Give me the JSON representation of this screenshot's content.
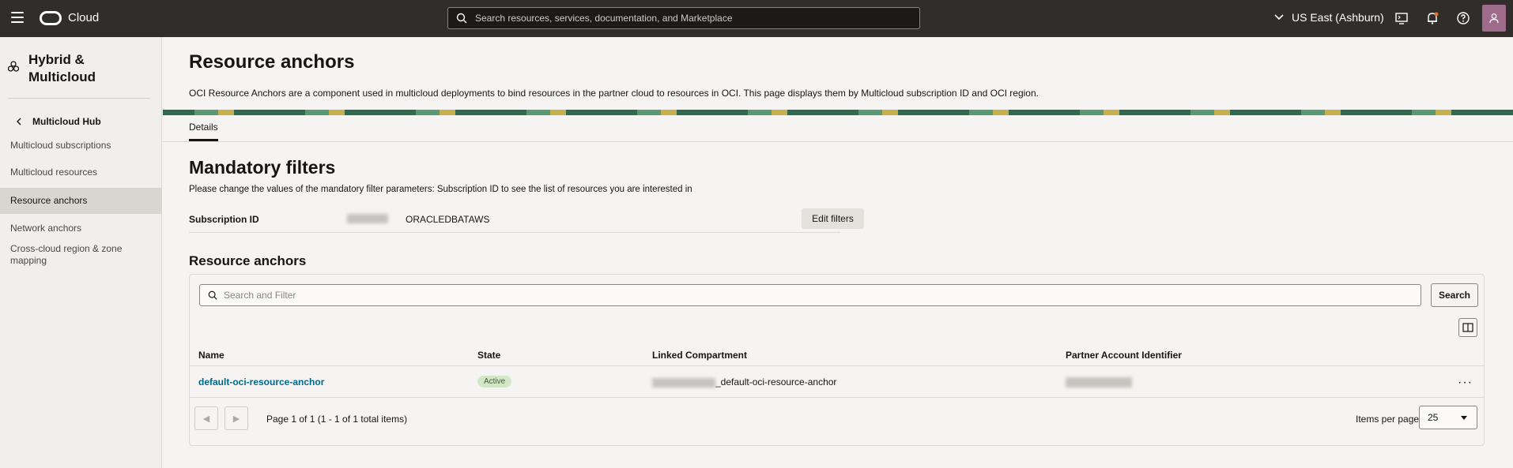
{
  "topbar": {
    "brand": "Cloud",
    "search_placeholder": "Search resources, services, documentation, and Marketplace",
    "region": "US East (Ashburn)"
  },
  "sidebar": {
    "title": "Hybrid & Multicloud",
    "back_label": "Multicloud Hub",
    "items": [
      {
        "label": "Multicloud subscriptions"
      },
      {
        "label": "Multicloud resources"
      },
      {
        "label": "Resource anchors"
      },
      {
        "label": "Network anchors"
      },
      {
        "label": "Cross-cloud region & zone mapping"
      }
    ]
  },
  "page": {
    "title": "Resource anchors",
    "description": "OCI Resource Anchors are a component used in multicloud deployments to bind resources in the partner cloud to resources in OCI. This page displays them by Multicloud subscription ID and OCI region.",
    "tab": "Details"
  },
  "filters": {
    "title": "Mandatory filters",
    "subtitle": "Please change the values of the mandatory filter parameters: Subscription ID to see the list of resources you are interested in",
    "label": "Subscription ID",
    "value": "ORACLEDBATAWS",
    "edit_button": "Edit filters"
  },
  "table": {
    "title": "Resource anchors",
    "search_placeholder": "Search and Filter",
    "search_button": "Search",
    "columns": [
      "Name",
      "State",
      "Linked Compartment",
      "Partner Account Identifier"
    ],
    "rows": [
      {
        "name": "default-oci-resource-anchor",
        "state": "Active",
        "compartment_suffix": "_default-oci-resource-anchor"
      }
    ],
    "pagination_text": "Page 1 of 1 (1 - 1 of 1 total items)",
    "items_per_page_label": "Items per page",
    "items_per_page_value": "25"
  }
}
